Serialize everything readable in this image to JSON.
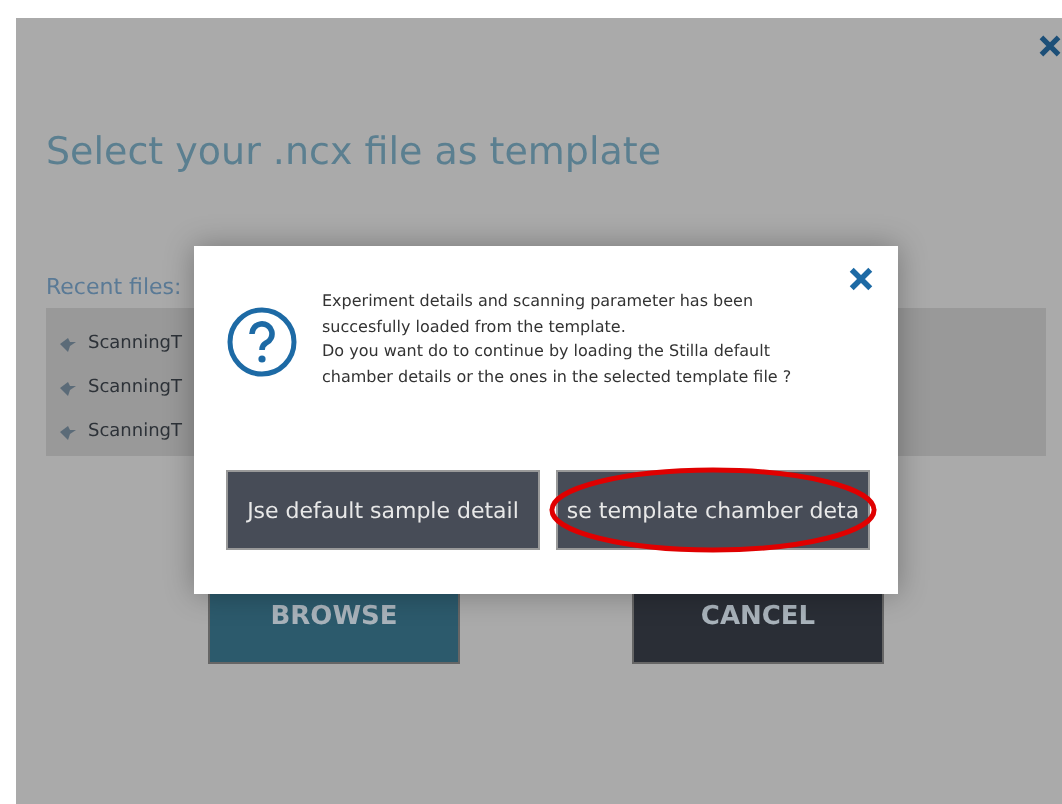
{
  "page": {
    "title": "Select your .ncx file as template",
    "recent_label": "Recent files:"
  },
  "recent_files": [
    {
      "name": "ScanningT"
    },
    {
      "name": "ScanningT"
    },
    {
      "name": "ScanningT"
    }
  ],
  "actions": [
    {
      "label": "BROWSE",
      "kind": "primary"
    },
    {
      "label": "CANCEL",
      "kind": "secondary"
    }
  ],
  "dialog": {
    "message": [
      "Experiment details and scanning parameter has been",
      "succesfully loaded from the template.",
      "Do you want do to continue by  loading the Stilla default",
      "chamber details or the ones in the selected template file ?"
    ],
    "buttons": [
      {
        "label": "Jse default sample detail",
        "highlighted": false
      },
      {
        "label": "se template chamber deta",
        "highlighted": true
      }
    ]
  }
}
